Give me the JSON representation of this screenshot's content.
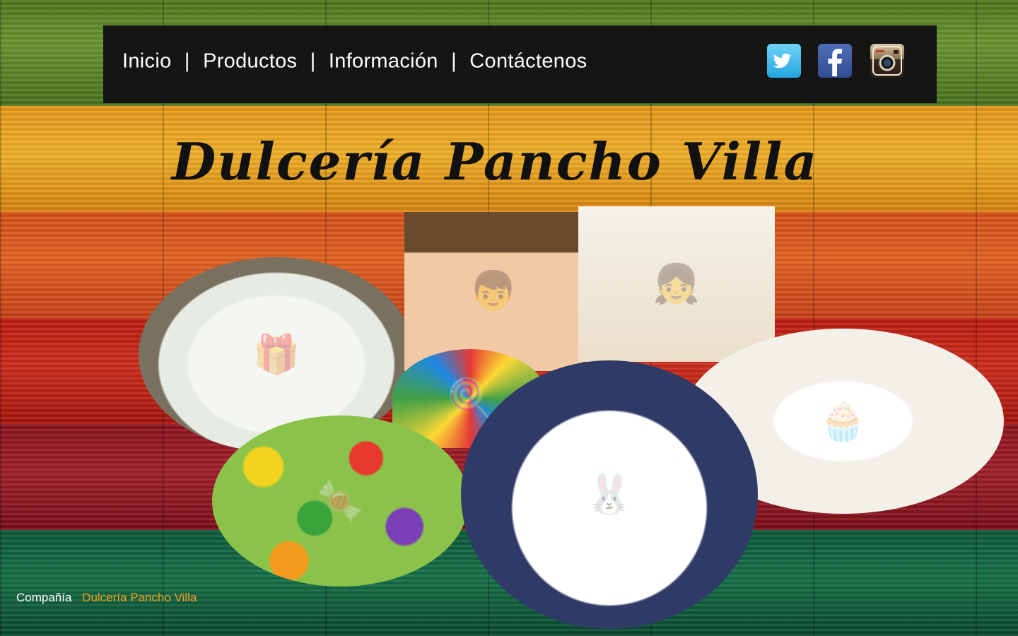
{
  "nav": {
    "links": [
      "Inicio",
      "Productos",
      "Información",
      "Contáctenos"
    ],
    "separator": "|",
    "social": {
      "twitter": {
        "icon": "twitter-icon",
        "glyph": "t"
      },
      "facebook": {
        "icon": "facebook-icon",
        "glyph": "f"
      },
      "instagram": {
        "icon": "instagram-icon",
        "glyph": "◉"
      }
    }
  },
  "header": {
    "title": "Dulcería Pancho Villa"
  },
  "gallery": [
    {
      "name": "gift-cake-photo",
      "glyph": "🎁"
    },
    {
      "name": "boy-lollipop-photo",
      "glyph": "👦"
    },
    {
      "name": "girl-chocolate-photo",
      "glyph": "👧"
    },
    {
      "name": "cupcakes-photo",
      "glyph": "🧁"
    },
    {
      "name": "fruit-candy-photo",
      "glyph": "🍬"
    },
    {
      "name": "lollipop-photo",
      "glyph": "🍭"
    },
    {
      "name": "bunny-cupcake-photo",
      "glyph": "🐰"
    }
  ],
  "footer": {
    "label": "Compañía",
    "company": "Dulcería Pancho Villa"
  },
  "colors": {
    "navbar": "#151515",
    "footer_accent": "#f0a020"
  }
}
